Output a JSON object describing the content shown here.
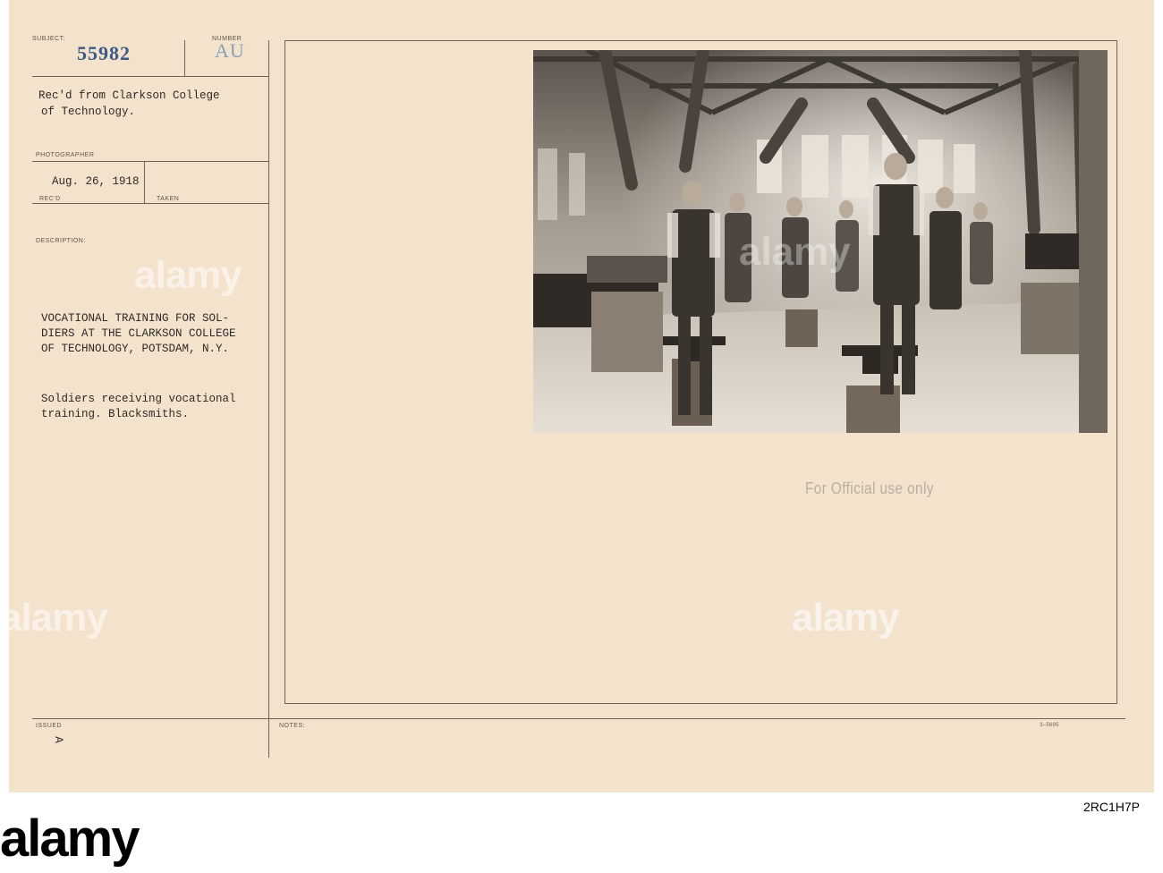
{
  "card": {
    "labels": {
      "subject": "SUBJECT:",
      "number": "NUMBER",
      "photographer": "PHOTOGRAPHER",
      "recd": "REC'D",
      "taken": "TAKEN",
      "description": "DESCRIPTION:",
      "issued": "ISSUED",
      "notes": "NOTES:"
    },
    "subject_number": "55982",
    "number_code": "AU",
    "received_from_line1": "Rec'd from Clarkson College",
    "received_from_line2": "of Technology.",
    "recd_date": "Aug. 26, 1918",
    "description_title_line1": "VOCATIONAL TRAINING FOR SOL-",
    "description_title_line2": "DIERS AT THE CLARKSON COLLEGE",
    "description_title_line3": "OF TECHNOLOGY, POTSDAM, N.Y.",
    "description_body_line1": "Soldiers receiving vocational",
    "description_body_line2": "training. Blacksmiths.",
    "issued_mark": "A",
    "official_stamp": "For Official use only",
    "form_code": "3—5605"
  },
  "watermark": {
    "text": "alamy",
    "image_id": "2RC1H7P"
  },
  "photo": {
    "description": "blacksmith-shop-photograph"
  }
}
